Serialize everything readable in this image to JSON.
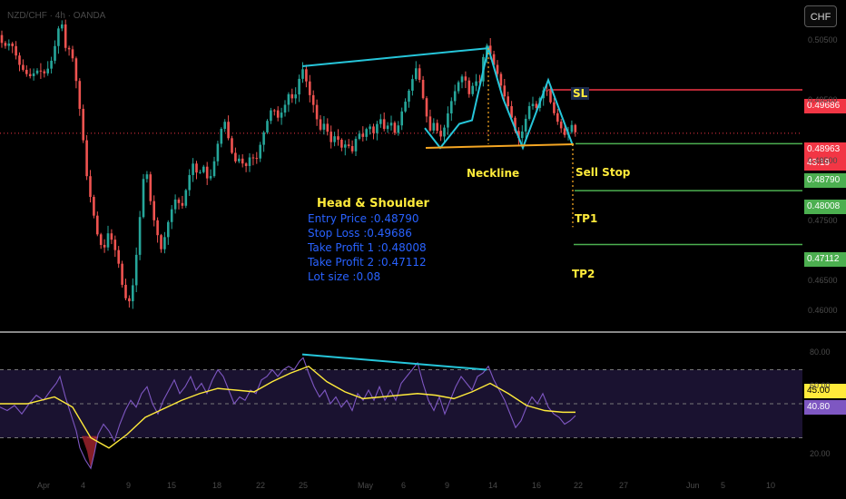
{
  "header": {
    "symbol": "NZD/CHF · 4h · OANDA",
    "currency_button": "CHF"
  },
  "annotations": {
    "sl": "SL",
    "neckline": "Neckline",
    "sell_stop": "Sell Stop",
    "tp1": "TP1",
    "tp2": "TP2"
  },
  "info_block": {
    "title": "Head & Shoulder",
    "lines": [
      "Entry Price :0.48790",
      "Stop Loss :0.49686",
      "Take Profit 1 :0.48008",
      "Take Profit 2 :0.47112",
      "Lot size :0.08"
    ]
  },
  "price_tags": {
    "sl": "0.49686",
    "current": "0.48963",
    "countdown": "43:19",
    "entry": "0.48790",
    "tp1": "0.48008",
    "tp2": "0.47112"
  },
  "rsi_tags": {
    "ma": "45.00",
    "rsi": "40.80"
  },
  "colors": {
    "up": "#26a69a",
    "down": "#ef5350",
    "pattern": "#26c6da",
    "neckline": "#f5a623",
    "sl": "#f23645",
    "green": "#4caf50",
    "rsi": "#7e57c2",
    "rsi_ma": "#ffeb3b",
    "blue_text": "#2962ff"
  },
  "chart_data": [
    {
      "type": "candlestick",
      "ylim": [
        0.4585,
        0.5085
      ],
      "price_axis_ticks": [
        "0.50500",
        "0.49500",
        "0.48500",
        "0.47500",
        "0.46500",
        "0.46000"
      ],
      "time_axis_ticks": [
        "Apr",
        "4",
        "9",
        "15",
        "18",
        "22",
        "25",
        "May",
        "6",
        "9",
        "14",
        "16",
        "22",
        "27",
        "Jun",
        "5",
        "10"
      ],
      "levels": [
        {
          "name": "SL",
          "value": 0.49686
        },
        {
          "name": "Current",
          "value": 0.48963
        },
        {
          "name": "Sell Stop",
          "value": 0.4879
        },
        {
          "name": "TP1",
          "value": 0.48008
        },
        {
          "name": "TP2",
          "value": 0.47112
        }
      ],
      "path": [
        [
          0,
          0.506
        ],
        [
          6,
          0.504
        ],
        [
          14,
          0.5048
        ],
        [
          24,
          0.5008
        ],
        [
          34,
          0.499
        ],
        [
          44,
          0.5002
        ],
        [
          52,
          0.4995
        ],
        [
          60,
          0.5022
        ],
        [
          66,
          0.507
        ],
        [
          70,
          0.508
        ],
        [
          75,
          0.503
        ],
        [
          80,
          0.504
        ],
        [
          86,
          0.4982
        ],
        [
          92,
          0.491
        ],
        [
          98,
          0.4818
        ],
        [
          104,
          0.477
        ],
        [
          110,
          0.4722
        ],
        [
          116,
          0.47
        ],
        [
          121,
          0.473
        ],
        [
          126,
          0.4716
        ],
        [
          132,
          0.4685
        ],
        [
          137,
          0.464
        ],
        [
          143,
          0.4608
        ],
        [
          148,
          0.464
        ],
        [
          153,
          0.4705
        ],
        [
          158,
          0.479
        ],
        [
          162,
          0.4852
        ],
        [
          166,
          0.48
        ],
        [
          170,
          0.4762
        ],
        [
          175,
          0.473
        ],
        [
          180,
          0.47
        ],
        [
          185,
          0.4735
        ],
        [
          190,
          0.4765
        ],
        [
          196,
          0.479
        ],
        [
          202,
          0.477
        ],
        [
          208,
          0.481
        ],
        [
          214,
          0.4848
        ],
        [
          220,
          0.4825
        ],
        [
          226,
          0.4842
        ],
        [
          232,
          0.4812
        ],
        [
          238,
          0.485
        ],
        [
          244,
          0.4895
        ],
        [
          249,
          0.492
        ],
        [
          254,
          0.4885
        ],
        [
          260,
          0.4848
        ],
        [
          266,
          0.4855
        ],
        [
          272,
          0.4838
        ],
        [
          278,
          0.486
        ],
        [
          284,
          0.485
        ],
        [
          290,
          0.4885
        ],
        [
          296,
          0.4915
        ],
        [
          302,
          0.4942
        ],
        [
          308,
          0.4922
        ],
        [
          314,
          0.4935
        ],
        [
          320,
          0.4962
        ],
        [
          326,
          0.495
        ],
        [
          332,
          0.499
        ],
        [
          336,
          0.5005
        ],
        [
          342,
          0.4965
        ],
        [
          348,
          0.494
        ],
        [
          354,
          0.49
        ],
        [
          360,
          0.4915
        ],
        [
          366,
          0.488
        ],
        [
          372,
          0.4895
        ],
        [
          378,
          0.4872
        ],
        [
          384,
          0.488
        ],
        [
          390,
          0.4866
        ],
        [
          396,
          0.4898
        ],
        [
          402,
          0.489
        ],
        [
          408,
          0.4912
        ],
        [
          414,
          0.4895
        ],
        [
          420,
          0.4925
        ],
        [
          426,
          0.49
        ],
        [
          432,
          0.4918
        ],
        [
          438,
          0.4892
        ],
        [
          444,
          0.493
        ],
        [
          450,
          0.4955
        ],
        [
          456,
          0.4985
        ],
        [
          461,
          0.5008
        ],
        [
          466,
          0.4972
        ],
        [
          471,
          0.493
        ],
        [
          476,
          0.49
        ],
        [
          481,
          0.4918
        ],
        [
          486,
          0.4885
        ],
        [
          492,
          0.4908
        ],
        [
          497,
          0.494
        ],
        [
          502,
          0.4962
        ],
        [
          508,
          0.4985
        ],
        [
          513,
          0.4995
        ],
        [
          519,
          0.496
        ],
        [
          525,
          0.4985
        ],
        [
          530,
          0.4978
        ],
        [
          535,
          0.503
        ],
        [
          539,
          0.5045
        ],
        [
          544,
          0.5018
        ],
        [
          550,
          0.4995
        ],
        [
          556,
          0.4965
        ],
        [
          562,
          0.494
        ],
        [
          567,
          0.4915
        ],
        [
          572,
          0.4885
        ],
        [
          577,
          0.4898
        ],
        [
          582,
          0.4925
        ],
        [
          587,
          0.4952
        ],
        [
          592,
          0.4935
        ],
        [
          598,
          0.496
        ],
        [
          603,
          0.4975
        ],
        [
          608,
          0.495
        ],
        [
          614,
          0.4922
        ],
        [
          620,
          0.4905
        ],
        [
          626,
          0.4888
        ],
        [
          631,
          0.4915
        ],
        [
          634,
          0.4898
        ]
      ],
      "pattern_lines": [
        [
          [
            333,
            0.5008
          ],
          [
            538,
            0.5038
          ]
        ],
        [
          [
            468,
            0.4905
          ],
          [
            485,
            0.4872
          ],
          [
            506,
            0.4912
          ],
          [
            520,
            0.4918
          ],
          [
            538,
            0.5038
          ],
          [
            554,
            0.4955
          ],
          [
            576,
            0.4872
          ],
          [
            604,
            0.4985
          ],
          [
            631,
            0.4876
          ]
        ],
        [
          [
            469,
            0.4872
          ],
          [
            632,
            0.4878
          ]
        ],
        [
          [
            538,
            0.5038
          ],
          [
            538,
            0.4878
          ]
        ],
        [
          [
            631,
            0.4878
          ],
          [
            631,
            0.474
          ]
        ]
      ]
    },
    {
      "type": "line",
      "ylim": [
        10,
        90
      ],
      "y_axis_ticks": [
        "80.00",
        "60.00",
        "20.00"
      ],
      "reference_lines": [
        70,
        50,
        30
      ],
      "series": [
        {
          "values": [
            [
              0,
              48
            ],
            [
              8,
              46
            ],
            [
              16,
              49
            ],
            [
              24,
              44
            ],
            [
              32,
              50
            ],
            [
              40,
              55
            ],
            [
              48,
              52
            ],
            [
              56,
              58
            ],
            [
              62,
              62
            ],
            [
              66,
              66
            ],
            [
              72,
              54
            ],
            [
              78,
              44
            ],
            [
              84,
              34
            ],
            [
              88,
              24
            ],
            [
              94,
              17
            ],
            [
              100,
              12
            ],
            [
              104,
              21
            ],
            [
              108,
              32
            ],
            [
              114,
              38
            ],
            [
              120,
              34
            ],
            [
              126,
              28
            ],
            [
              132,
              38
            ],
            [
              138,
              46
            ],
            [
              144,
              52
            ],
            [
              150,
              48
            ],
            [
              156,
              56
            ],
            [
              162,
              60
            ],
            [
              168,
              50
            ],
            [
              174,
              44
            ],
            [
              180,
              52
            ],
            [
              186,
              58
            ],
            [
              192,
              64
            ],
            [
              198,
              56
            ],
            [
              204,
              60
            ],
            [
              210,
              66
            ],
            [
              216,
              58
            ],
            [
              222,
              62
            ],
            [
              228,
              56
            ],
            [
              234,
              64
            ],
            [
              240,
              70
            ],
            [
              246,
              66
            ],
            [
              252,
              58
            ],
            [
              258,
              50
            ],
            [
              264,
              54
            ],
            [
              270,
              52
            ],
            [
              276,
              58
            ],
            [
              282,
              56
            ],
            [
              288,
              64
            ],
            [
              294,
              66
            ],
            [
              300,
              70
            ],
            [
              306,
              66
            ],
            [
              312,
              70
            ],
            [
              318,
              72
            ],
            [
              324,
              70
            ],
            [
              330,
              75
            ],
            [
              334,
              77
            ],
            [
              340,
              68
            ],
            [
              346,
              60
            ],
            [
              352,
              54
            ],
            [
              358,
              58
            ],
            [
              364,
              50
            ],
            [
              370,
              54
            ],
            [
              376,
              48
            ],
            [
              382,
              52
            ],
            [
              388,
              46
            ],
            [
              394,
              56
            ],
            [
              400,
              52
            ],
            [
              406,
              58
            ],
            [
              412,
              52
            ],
            [
              418,
              60
            ],
            [
              424,
              52
            ],
            [
              430,
              58
            ],
            [
              436,
              52
            ],
            [
              442,
              62
            ],
            [
              448,
              66
            ],
            [
              454,
              70
            ],
            [
              460,
              74
            ],
            [
              466,
              62
            ],
            [
              472,
              52
            ],
            [
              478,
              46
            ],
            [
              484,
              54
            ],
            [
              490,
              44
            ],
            [
              496,
              52
            ],
            [
              502,
              60
            ],
            [
              508,
              66
            ],
            [
              514,
              62
            ],
            [
              520,
              58
            ],
            [
              526,
              66
            ],
            [
              532,
              68
            ],
            [
              538,
              72
            ],
            [
              544,
              64
            ],
            [
              550,
              58
            ],
            [
              556,
              52
            ],
            [
              562,
              44
            ],
            [
              568,
              36
            ],
            [
              574,
              40
            ],
            [
              580,
              48
            ],
            [
              586,
              54
            ],
            [
              592,
              50
            ],
            [
              598,
              56
            ],
            [
              604,
              48
            ],
            [
              610,
              44
            ],
            [
              616,
              42
            ],
            [
              622,
              38
            ],
            [
              628,
              40
            ],
            [
              634,
              43
            ]
          ]
        },
        {
          "values": [
            [
              0,
              50
            ],
            [
              30,
              50
            ],
            [
              60,
              54
            ],
            [
              80,
              48
            ],
            [
              100,
              30
            ],
            [
              120,
              24
            ],
            [
              140,
              32
            ],
            [
              160,
              42
            ],
            [
              180,
              47
            ],
            [
              200,
              52
            ],
            [
              220,
              56
            ],
            [
              240,
              59
            ],
            [
              260,
              58
            ],
            [
              280,
              57
            ],
            [
              300,
              63
            ],
            [
              320,
              68
            ],
            [
              340,
              72
            ],
            [
              360,
              63
            ],
            [
              380,
              57
            ],
            [
              400,
              53
            ],
            [
              420,
              54
            ],
            [
              440,
              55
            ],
            [
              460,
              56
            ],
            [
              480,
              55
            ],
            [
              500,
              53
            ],
            [
              520,
              57
            ],
            [
              540,
              62
            ],
            [
              560,
              56
            ],
            [
              580,
              49
            ],
            [
              600,
              46
            ],
            [
              620,
              45
            ],
            [
              634,
              45
            ]
          ]
        }
      ],
      "divergence_line": [
        [
          333,
          79
        ],
        [
          536,
          70
        ]
      ],
      "oversold_area": [
        [
          90,
          31
        ],
        [
          96,
          22
        ],
        [
          100,
          12
        ],
        [
          104,
          21
        ],
        [
          108,
          31
        ]
      ]
    }
  ]
}
